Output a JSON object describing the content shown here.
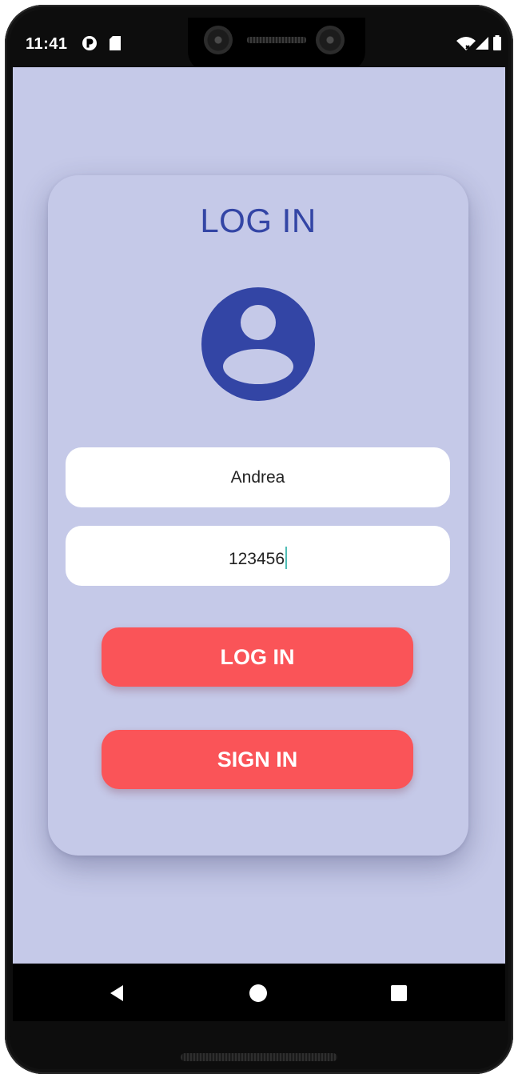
{
  "status_bar": {
    "time": "11:41",
    "icons": [
      "app-notification-icon",
      "sd-card-icon",
      "wifi-no-internet-icon",
      "cell-signal-icon",
      "battery-icon"
    ]
  },
  "login": {
    "title": "LOG IN",
    "avatar_icon": "account-circle-icon",
    "username_value": "Andrea",
    "password_value": "123456",
    "login_button_label": "LOG IN",
    "signin_button_label": "SIGN IN"
  },
  "nav_bar": {
    "icons": [
      "back-icon",
      "home-icon",
      "recents-icon"
    ]
  },
  "colors": {
    "background": "#c5c9e8",
    "accent": "#3345a5",
    "button": "#fa5458"
  }
}
